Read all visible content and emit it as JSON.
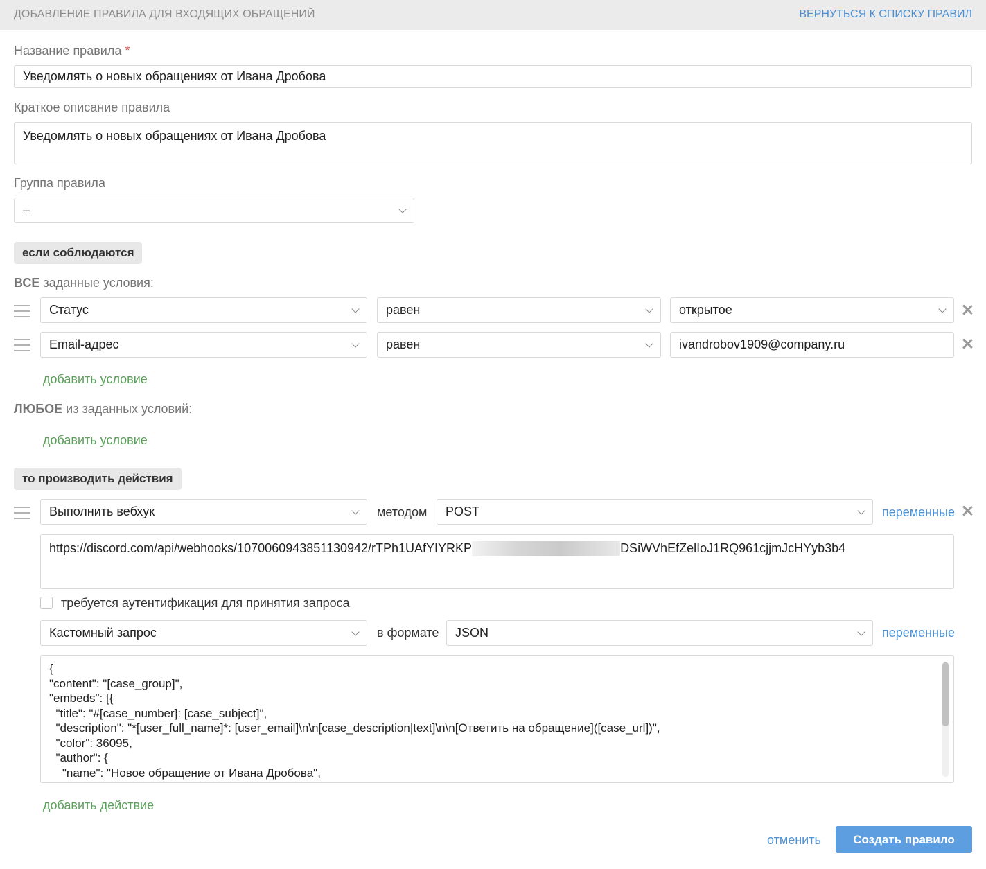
{
  "header": {
    "title": "ДОБАВЛЕНИЕ ПРАВИЛА ДЛЯ ВХОДЯЩИХ ОБРАЩЕНИЙ",
    "back_link": "ВЕРНУТЬСЯ К СПИСКУ ПРАВИЛ"
  },
  "form": {
    "name_label": "Название правила",
    "name_required_mark": "*",
    "name_value": "Уведомлять о новых обращениях от Ивана Дробова",
    "description_label": "Краткое описание правила",
    "description_value": "Уведомлять о новых обращениях от Ивана Дробова",
    "group_label": "Группа правила",
    "group_value": "–"
  },
  "conditions": {
    "section_title": "если соблюдаются",
    "all_label_strong": "ВСЕ",
    "all_label_rest": " заданные условия:",
    "all_rows": [
      {
        "field": "Статус",
        "operator": "равен",
        "value": "открытое"
      },
      {
        "field": "Email-адрес",
        "operator": "равен",
        "value": "ivandrobov1909@company.ru"
      }
    ],
    "add_condition_all": "добавить условие",
    "any_label_strong": "ЛЮБОЕ",
    "any_label_rest": " из заданных условий:",
    "add_condition_any": "добавить условие"
  },
  "actions": {
    "section_title": "то производить действия",
    "action_type": "Выполнить вебхук",
    "method_label": "методом",
    "method_value": "POST",
    "variables_link_1": "переменные",
    "url_start": "https://discord.com/api/webhooks/1070060943851130942/rTPh1UAfYIYRKP",
    "url_end": "DSiWVhEfZelIoJ1RQ961cjjmJcHYyb3b4",
    "auth_checkbox_label": "требуется аутентификация для принятия запроса",
    "request_type": "Кастомный запрос",
    "format_label": "в формате",
    "format_value": "JSON",
    "variables_link_2": "переменные",
    "body_lines": [
      "{",
      "\"content\": \"[case_group]\",",
      "\"embeds\": [{",
      "  \"title\": \"#[case_number]: [case_subject]\",",
      "  \"description\": \"*[user_full_name]*: [user_email]\\n\\n[case_description|text]\\n\\n[Ответить на обращение]([case_url])\",",
      "  \"color\": 36095,",
      "  \"author\": {",
      "    \"name\": \"Новое обращение от Ивана Дробова\","
    ],
    "add_action": "добавить действие"
  },
  "footer": {
    "cancel": "отменить",
    "submit": "Создать правило"
  },
  "colors": {
    "accent_blue": "#4a90d2",
    "button_blue": "#5d9ee0",
    "link_green": "#5aa05a",
    "required_red": "#d9534f"
  }
}
